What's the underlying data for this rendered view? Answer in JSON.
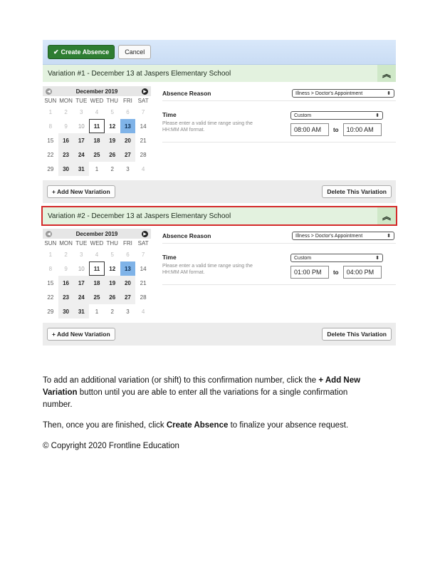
{
  "toolbar": {
    "create_label": "Create Absence",
    "cancel_label": "Cancel"
  },
  "variations": [
    {
      "title": "Variation #1 - December 13  at  Jaspers Elementary School",
      "calendar": {
        "month": "December 2019",
        "dow": [
          "SUN",
          "MON",
          "TUE",
          "WED",
          "THU",
          "FRI",
          "SAT"
        ],
        "days": [
          [
            "1",
            "other"
          ],
          [
            "2",
            "other"
          ],
          [
            "3",
            "other"
          ],
          [
            "4",
            "other"
          ],
          [
            "5",
            "other"
          ],
          [
            "6",
            "other"
          ],
          [
            "7",
            "other"
          ],
          [
            "8",
            "other"
          ],
          [
            "9",
            "other"
          ],
          [
            "10",
            "muted"
          ],
          [
            "11",
            "today"
          ],
          [
            "12",
            "bold"
          ],
          [
            "13",
            "sel"
          ],
          [
            "14",
            "weekend"
          ],
          [
            "15",
            "weekend"
          ],
          [
            "16",
            "avail"
          ],
          [
            "17",
            "avail"
          ],
          [
            "18",
            "avail"
          ],
          [
            "19",
            "avail"
          ],
          [
            "20",
            "avail"
          ],
          [
            "21",
            "weekend"
          ],
          [
            "22",
            "weekend"
          ],
          [
            "23",
            "avail"
          ],
          [
            "24",
            "avail"
          ],
          [
            "25",
            "avail"
          ],
          [
            "26",
            "avail"
          ],
          [
            "27",
            "avail"
          ],
          [
            "28",
            "weekend"
          ],
          [
            "29",
            "weekend"
          ],
          [
            "30",
            "avail"
          ],
          [
            "31",
            "avail"
          ],
          [
            "1",
            "weekend"
          ],
          [
            "2",
            "weekend"
          ],
          [
            "3",
            "weekend"
          ],
          [
            "4",
            "other"
          ]
        ]
      },
      "absence_reason_label": "Absence Reason",
      "absence_reason_value": "Illness > Doctor's Appointment",
      "time_label": "Time",
      "time_hint": "Please enter a valid time range using the HH:MM AM format.",
      "time_type": "Custom",
      "start_time": "08:00 AM",
      "to_label": "to",
      "end_time": "10:00 AM",
      "add_label": "+ Add New Variation",
      "delete_label": "Delete This Variation"
    },
    {
      "title": "Variation #2 - December 13  at  Jaspers Elementary School",
      "calendar": {
        "month": "December 2019",
        "dow": [
          "SUN",
          "MON",
          "TUE",
          "WED",
          "THU",
          "FRI",
          "SAT"
        ],
        "days": [
          [
            "1",
            "other"
          ],
          [
            "2",
            "other"
          ],
          [
            "3",
            "other"
          ],
          [
            "4",
            "other"
          ],
          [
            "5",
            "other"
          ],
          [
            "6",
            "other"
          ],
          [
            "7",
            "other"
          ],
          [
            "8",
            "other"
          ],
          [
            "9",
            "other"
          ],
          [
            "10",
            "muted"
          ],
          [
            "11",
            "today"
          ],
          [
            "12",
            "bold"
          ],
          [
            "13",
            "sel"
          ],
          [
            "14",
            "weekend"
          ],
          [
            "15",
            "weekend"
          ],
          [
            "16",
            "avail"
          ],
          [
            "17",
            "avail"
          ],
          [
            "18",
            "avail"
          ],
          [
            "19",
            "avail"
          ],
          [
            "20",
            "avail"
          ],
          [
            "21",
            "weekend"
          ],
          [
            "22",
            "weekend"
          ],
          [
            "23",
            "avail"
          ],
          [
            "24",
            "avail"
          ],
          [
            "25",
            "avail"
          ],
          [
            "26",
            "avail"
          ],
          [
            "27",
            "avail"
          ],
          [
            "28",
            "weekend"
          ],
          [
            "29",
            "weekend"
          ],
          [
            "30",
            "avail"
          ],
          [
            "31",
            "avail"
          ],
          [
            "1",
            "weekend"
          ],
          [
            "2",
            "weekend"
          ],
          [
            "3",
            "weekend"
          ],
          [
            "4",
            "other"
          ]
        ]
      },
      "absence_reason_label": "Absence Reason",
      "absence_reason_value": "Illness > Doctor's Appointment",
      "time_label": "Time",
      "time_hint": "Please enter a valid time range using the HH:MM AM format.",
      "time_type": "Custom",
      "start_time": "01:00 PM",
      "to_label": "to",
      "end_time": "04:00 PM",
      "add_label": "+ Add New Variation",
      "delete_label": "Delete This Variation"
    }
  ],
  "instructions": {
    "p1_a": "To add an additional variation (or shift) to this confirmation number, click the ",
    "p1_b": "+ Add New Variation",
    "p1_c": " button until you are able to enter all the variations for a single confirmation number.",
    "p2_a": "Then, once you are finished, click ",
    "p2_b": "Create Absence",
    "p2_c": " to finalize your absence request.",
    "copyright": "© Copyright 2020 Frontline Education"
  },
  "icons": {
    "checkmark": "check-icon",
    "collapse": "chevron-double-up-icon",
    "prev": "chevron-left-icon",
    "next": "chevron-right-icon"
  }
}
